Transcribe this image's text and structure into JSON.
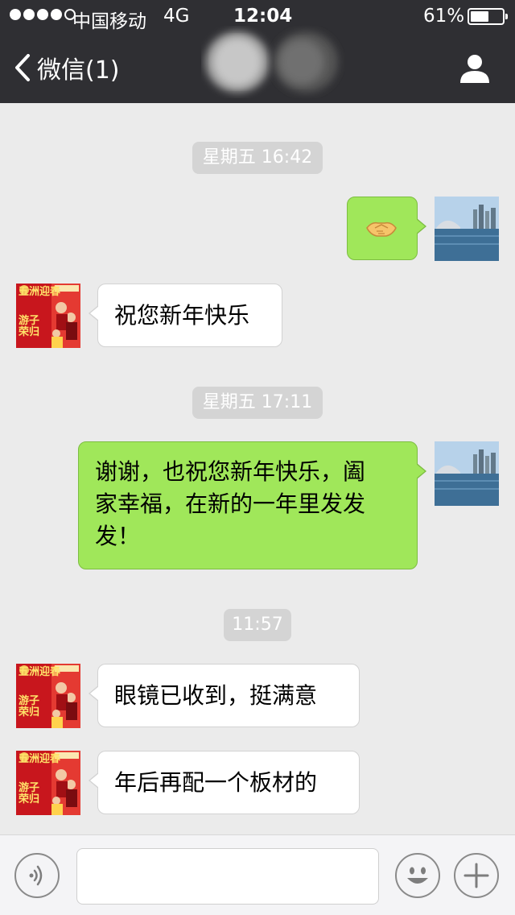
{
  "status_bar": {
    "carrier": "中国移动",
    "network": "4G",
    "time": "12:04",
    "battery_percent": "61%",
    "battery_level": 0.61,
    "signal_dots": 5,
    "signal_filled": 4
  },
  "nav": {
    "back_label": "微信(1)",
    "back_icon": "chevron-left-icon",
    "profile_icon": "person-icon",
    "title_obscured": true
  },
  "messages": [
    {
      "type": "timestamp",
      "text": "星期五 16:42"
    },
    {
      "type": "message",
      "side": "right",
      "sender_avatar": "self-harbor-avatar",
      "content": "handshake-emoji"
    },
    {
      "type": "message",
      "side": "left",
      "sender_avatar": "contact-poster-avatar",
      "text": "祝您新年快乐"
    },
    {
      "type": "timestamp",
      "text": "星期五 17:11"
    },
    {
      "type": "message",
      "side": "right",
      "sender_avatar": "self-harbor-avatar",
      "lines": [
        "谢谢，也祝您新年快乐，阖",
        "家幸福，在新的一年里发发",
        "发！"
      ]
    },
    {
      "type": "timestamp",
      "text": "11:57"
    },
    {
      "type": "message",
      "side": "left",
      "sender_avatar": "contact-poster-avatar",
      "text": "眼镜已收到，挺满意"
    },
    {
      "type": "message",
      "side": "left",
      "sender_avatar": "contact-poster-avatar",
      "text": "年后再配一个板材的"
    }
  ],
  "contact_avatar": {
    "poster_text": [
      "五",
      "洲",
      "迎",
      "春",
      "游",
      "子",
      "荣",
      "归"
    ]
  },
  "input_bar": {
    "voice_icon": "voice-icon",
    "emoji_icon": "emoji-icon",
    "plus_icon": "plus-icon",
    "input_value": ""
  },
  "colors": {
    "nav_bg": "#2f2f33",
    "chat_bg": "#ebebeb",
    "self_bubble": "#a0e75a",
    "other_bubble": "#ffffff",
    "timestamp_bg": "#d4d4d4"
  }
}
